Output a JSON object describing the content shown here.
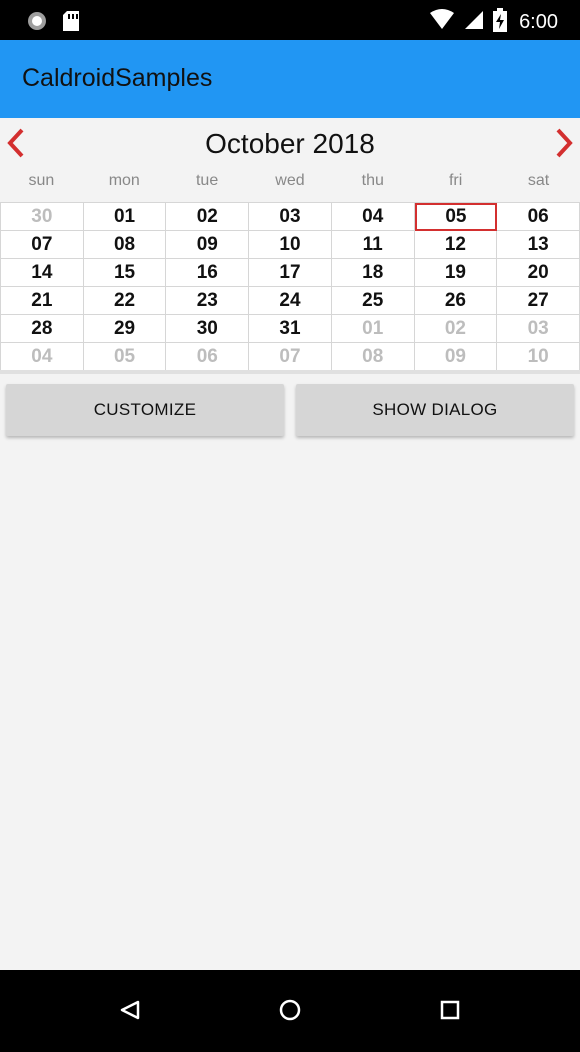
{
  "status_bar": {
    "time": "6:00"
  },
  "app_bar": {
    "title": "CaldroidSamples"
  },
  "calendar": {
    "month_title": "October 2018",
    "weekdays": [
      "sun",
      "mon",
      "tue",
      "wed",
      "thu",
      "fri",
      "sat"
    ],
    "days": [
      {
        "label": "30",
        "other": true
      },
      {
        "label": "01"
      },
      {
        "label": "02"
      },
      {
        "label": "03"
      },
      {
        "label": "04"
      },
      {
        "label": "05",
        "today": true
      },
      {
        "label": "06"
      },
      {
        "label": "07"
      },
      {
        "label": "08"
      },
      {
        "label": "09"
      },
      {
        "label": "10"
      },
      {
        "label": "11"
      },
      {
        "label": "12"
      },
      {
        "label": "13"
      },
      {
        "label": "14"
      },
      {
        "label": "15"
      },
      {
        "label": "16"
      },
      {
        "label": "17"
      },
      {
        "label": "18"
      },
      {
        "label": "19"
      },
      {
        "label": "20"
      },
      {
        "label": "21"
      },
      {
        "label": "22"
      },
      {
        "label": "23"
      },
      {
        "label": "24"
      },
      {
        "label": "25"
      },
      {
        "label": "26"
      },
      {
        "label": "27"
      },
      {
        "label": "28"
      },
      {
        "label": "29"
      },
      {
        "label": "30"
      },
      {
        "label": "31"
      },
      {
        "label": "01",
        "other": true
      },
      {
        "label": "02",
        "other": true
      },
      {
        "label": "03",
        "other": true
      },
      {
        "label": "04",
        "other": true
      },
      {
        "label": "05",
        "other": true
      },
      {
        "label": "06",
        "other": true
      },
      {
        "label": "07",
        "other": true
      },
      {
        "label": "08",
        "other": true
      },
      {
        "label": "09",
        "other": true
      },
      {
        "label": "10",
        "other": true
      }
    ],
    "selected_color": "#d32f2f"
  },
  "buttons": {
    "customize": "CUSTOMIZE",
    "show_dialog": "SHOW DIALOG"
  },
  "icons": {
    "status": [
      "record-icon",
      "sd-card-icon",
      "wifi-icon",
      "signal-icon",
      "battery-charging-icon"
    ],
    "nav": [
      "back-icon",
      "home-icon",
      "recents-icon"
    ],
    "calendar": [
      "chevron-left-icon",
      "chevron-right-icon"
    ]
  },
  "colors": {
    "app_bar": "#2196f3",
    "arrow": "#d32f2f"
  }
}
